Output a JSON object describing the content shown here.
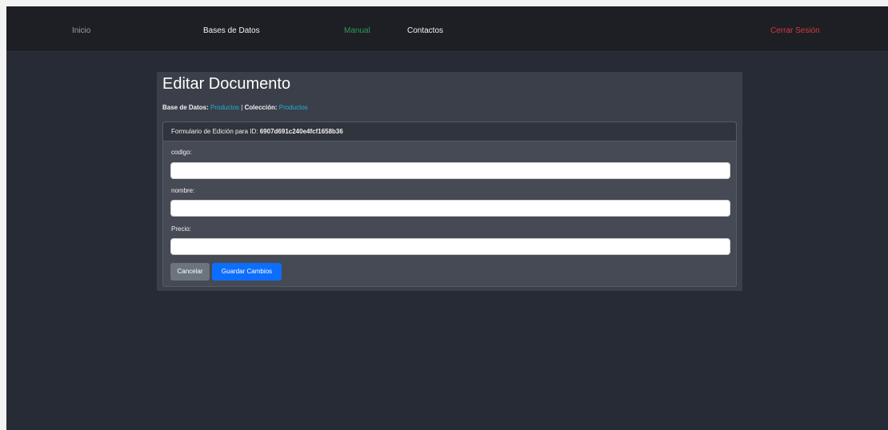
{
  "nav": {
    "inicio": "Inicio",
    "bases": "Bases de Datos",
    "manual": "Manual",
    "contactos": "Contactos",
    "logout": "Cerrar Sesión"
  },
  "page": {
    "title": "Editar Documento",
    "db_label": "Base de Datos:",
    "db_value": "Productos",
    "separator": "|",
    "collection_label": "Colección:",
    "collection_value": "Productos"
  },
  "form": {
    "header_label": "Formulario de Edición para ID:",
    "doc_id": "6907d691c240e4fcf1658b36",
    "fields": [
      {
        "label": "codigo:",
        "value": ""
      },
      {
        "label": "nombre:",
        "value": ""
      },
      {
        "label": "Precio:",
        "value": ""
      }
    ],
    "cancel_label": "Cancelar",
    "save_label": "Guardar Cambios"
  },
  "colors": {
    "nav_bg": "#1d1f24",
    "page_bg": "#272b35",
    "card_bg": "#3a3f49",
    "link": "#1fb3d6",
    "manual": "#2e9a54",
    "logout": "#d63b3b",
    "primary": "#0d6efd",
    "secondary": "#6c757d"
  }
}
